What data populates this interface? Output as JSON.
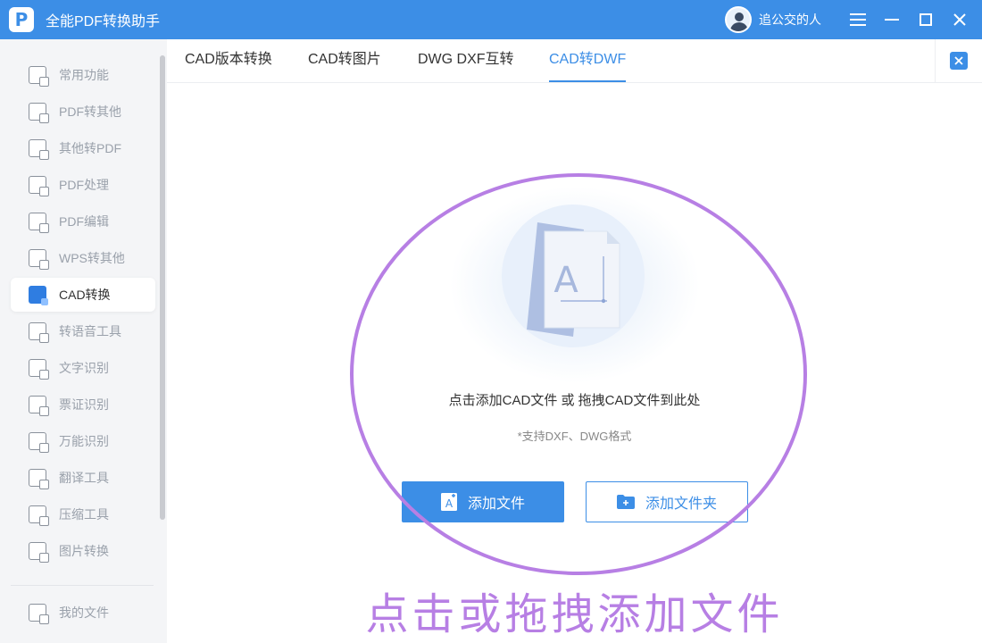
{
  "app": {
    "title": "全能PDF转换助手",
    "logo_letter": "P"
  },
  "user": {
    "name": "追公交的人"
  },
  "window_controls": [
    "menu-icon",
    "minimize-icon",
    "maximize-icon",
    "close-icon"
  ],
  "sidebar": {
    "items": [
      {
        "label": "常用功能",
        "icon": "star-doc-icon",
        "active": false
      },
      {
        "label": "PDF转其他",
        "icon": "pdf-export-icon",
        "active": false
      },
      {
        "label": "其他转PDF",
        "icon": "pdf-import-icon",
        "active": false
      },
      {
        "label": "PDF处理",
        "icon": "pdf-process-icon",
        "active": false
      },
      {
        "label": "PDF编辑",
        "icon": "pdf-edit-icon",
        "active": false
      },
      {
        "label": "WPS转其他",
        "icon": "wps-icon",
        "active": false
      },
      {
        "label": "CAD转换",
        "icon": "cad-icon",
        "active": true
      },
      {
        "label": "转语音工具",
        "icon": "speech-icon",
        "active": false
      },
      {
        "label": "文字识别",
        "icon": "ocr-icon",
        "active": false
      },
      {
        "label": "票证识别",
        "icon": "ticket-icon",
        "active": false
      },
      {
        "label": "万能识别",
        "icon": "eye-icon",
        "active": false
      },
      {
        "label": "翻译工具",
        "icon": "translate-icon",
        "active": false
      },
      {
        "label": "压缩工具",
        "icon": "zip-icon",
        "active": false
      },
      {
        "label": "图片转换",
        "icon": "image-icon",
        "active": false
      }
    ],
    "footer": {
      "label": "我的文件",
      "icon": "my-files-icon"
    }
  },
  "tabs": [
    {
      "label": "CAD版本转换",
      "active": false
    },
    {
      "label": "CAD转图片",
      "active": false
    },
    {
      "label": "DWG DXF互转",
      "active": false
    },
    {
      "label": "CAD转DWF",
      "active": true
    }
  ],
  "drop_zone": {
    "illustration_letter": "A",
    "instruction": "点击添加CAD文件 或 拖拽CAD文件到此处",
    "hint": "*支持DXF、DWG格式",
    "add_file_label": "添加文件",
    "add_folder_label": "添加文件夹"
  },
  "annotation": {
    "text": "点击或拖拽添加文件",
    "color": "#b77fe4"
  },
  "colors": {
    "accent": "#3c8ee6",
    "annotation": "#b77fe4",
    "sidebar_bg": "#f4f5f7"
  }
}
